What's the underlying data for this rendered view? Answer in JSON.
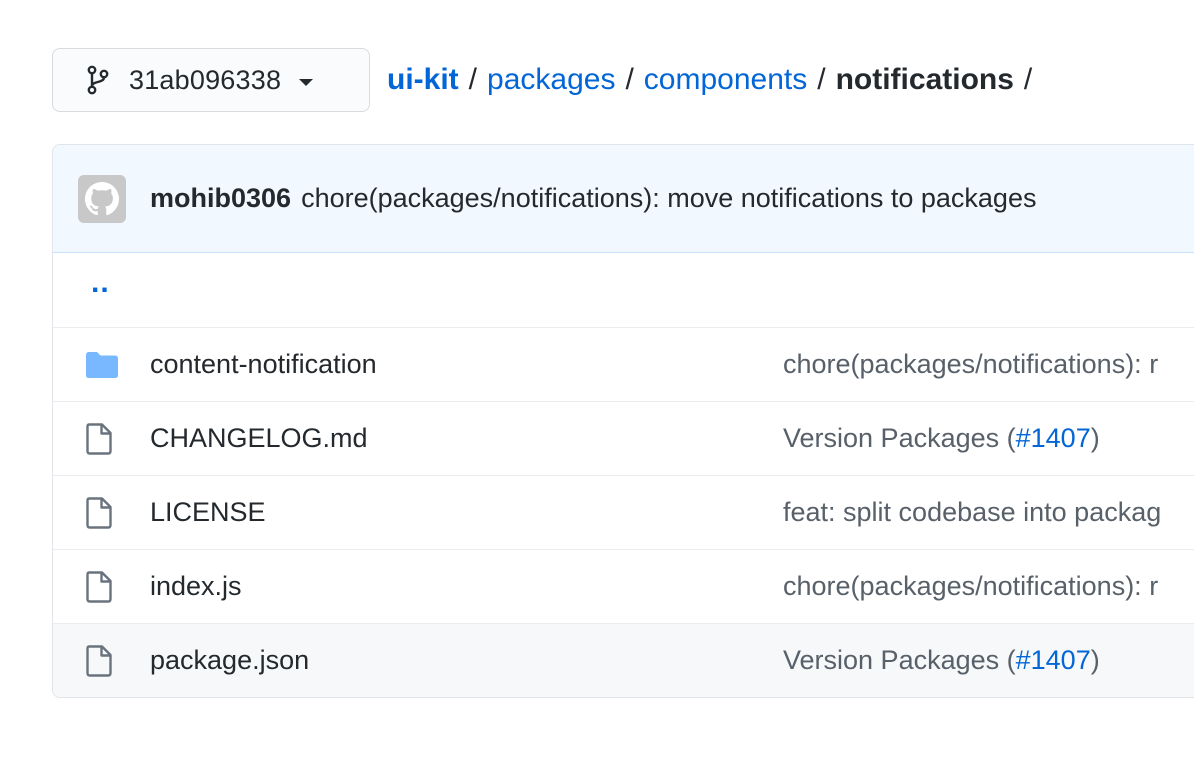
{
  "branch": {
    "name": "31ab096338"
  },
  "breadcrumb": {
    "repo": "ui-kit",
    "parts": [
      "packages",
      "components"
    ],
    "current": "notifications",
    "separator": "/"
  },
  "latest_commit": {
    "author": "mohib0306",
    "message": "chore(packages/notifications): move notifications to packages"
  },
  "parent_dir": "..",
  "files": [
    {
      "name": "content-notification",
      "type": "folder",
      "msg_text": "chore(packages/notifications): r",
      "link": "",
      "msg_after": ""
    },
    {
      "name": "CHANGELOG.md",
      "type": "file",
      "msg_text": "Version Packages (",
      "link": "#1407",
      "msg_after": ")"
    },
    {
      "name": "LICENSE",
      "type": "file",
      "msg_text": "feat: split codebase into packag",
      "link": "",
      "msg_after": ""
    },
    {
      "name": "index.js",
      "type": "file",
      "msg_text": "chore(packages/notifications): r",
      "link": "",
      "msg_after": ""
    },
    {
      "name": "package.json",
      "type": "file",
      "msg_text": "Version Packages (",
      "link": "#1407",
      "msg_after": ")"
    }
  ],
  "colors": {
    "link": "#0366d6",
    "folder_icon": "#79b8ff",
    "file_icon": "#6a737d",
    "commit_bar": "#f1f8ff"
  }
}
